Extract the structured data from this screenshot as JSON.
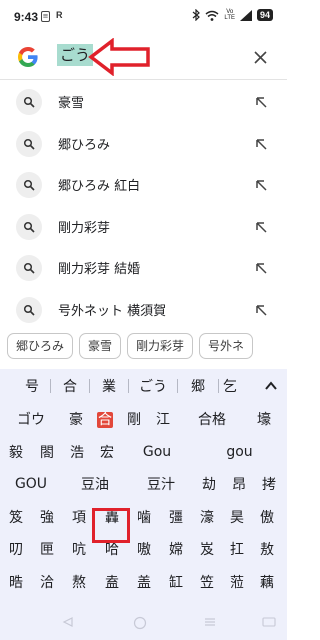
{
  "status_bar": {
    "time": "9:43",
    "left_icons": [
      "message-icon",
      "r-icon"
    ],
    "right_icons": [
      "bluetooth-icon",
      "wifi-icon",
      "volte-icon",
      "signal-icon"
    ],
    "volte_top": "Vo",
    "volte_bottom": "LTE",
    "battery": "94"
  },
  "search": {
    "query": "ごう"
  },
  "suggestions": [
    {
      "text": "豪雪"
    },
    {
      "text": "郷ひろみ"
    },
    {
      "text": "郷ひろみ 紅白"
    },
    {
      "text": "剛力彩芽"
    },
    {
      "text": "剛力彩芽 結婚"
    },
    {
      "text": "号外ネット 横須賀"
    }
  ],
  "chips": [
    "郷ひろみ",
    "豪雪",
    "剛力彩芽",
    "号外ネ"
  ],
  "keyboard": {
    "top_candidates": [
      "号",
      "合",
      "業",
      "ごう",
      "郷",
      "乞"
    ],
    "rows": [
      [
        "ゴウ",
        "豪",
        "合",
        "剛",
        "江",
        "合格",
        "壕"
      ],
      [
        "毅",
        "閤",
        "浩",
        "宏",
        "Gou",
        "gou"
      ],
      [
        "GOU",
        "豆油",
        "豆汁",
        "劫",
        "昂",
        "拷"
      ],
      [
        "笈",
        "強",
        "項",
        "轟",
        "噛",
        "彊",
        "濠",
        "昊",
        "傲"
      ],
      [
        "叨",
        "匣",
        "吭",
        "哈",
        "嗷",
        "嫦",
        "岌",
        "扛",
        "敖"
      ],
      [
        "晧",
        "洽",
        "熬",
        "盍",
        "盖",
        "缸",
        "笠",
        "蒞",
        "藕"
      ]
    ]
  },
  "colors": {
    "query_highlight": "#a8dccf",
    "keyboard_bg": "#eef0fb",
    "annotation_red": "#e0212b",
    "selected_candidate": "#e2473a"
  }
}
